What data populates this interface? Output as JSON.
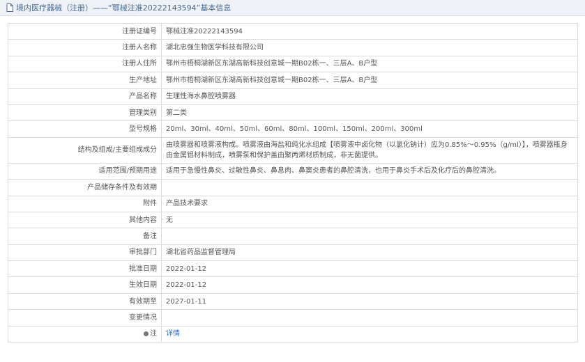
{
  "header": {
    "breadcrumb": "境内医疗器械（注册）——“鄂械注准20222143594”基本信息"
  },
  "rows": [
    {
      "label": "注册证编号",
      "value": "鄂械注准20222143594"
    },
    {
      "label": "注册人名称",
      "value": "湖北忠强生物医学科技有限公司"
    },
    {
      "label": "注册人住所",
      "value": "鄂州市梧桐湖新区东湖高新科技创意城一期B02栋一、三层A、B户型"
    },
    {
      "label": "生产地址",
      "value": "鄂州市梧桐湖新区东湖高新科技创意城一期B02栋一、三层A、B户型"
    },
    {
      "label": "产品名称",
      "value": "生理性海水鼻腔喷雾器"
    },
    {
      "label": "管理类别",
      "value": "第二类"
    },
    {
      "label": "型号规格",
      "value": "20ml、30ml、40ml、50ml、60ml、80ml、100ml、150ml、200ml、300ml"
    },
    {
      "label": "结构及组成/主要组成成分",
      "value": "由喷雾器和喷雾液构成。喷雾液由海盐和纯化水组成【喷雾液中卤化物（以氯化钠计）应为0.85%～0.95%（g/ml）】，喷雾器瓶身由金属铝材料制成，喷雾泵和保护盖由聚丙烯材质制成，非无菌提供。"
    },
    {
      "label": "适用范围/预期用途",
      "value": "适用于急慢性鼻炎、过敏性鼻炎、鼻息肉、鼻窦炎患者的鼻腔清洗，也用于鼻炎手术后及化疗后的鼻腔清洗。"
    },
    {
      "label": "产品储存条件及有效期",
      "value": ""
    },
    {
      "label": "附件",
      "value": "产品技术要求"
    },
    {
      "label": "其他内容",
      "value": "无"
    },
    {
      "label": "备注",
      "value": ""
    },
    {
      "label": "审批部门",
      "value": "湖北省药品监督管理局"
    },
    {
      "label": "批准日期",
      "value": "2022-01-12"
    },
    {
      "label": "生效日期",
      "value": "2022-01-12"
    },
    {
      "label": "有效期至",
      "value": "2027-01-11"
    },
    {
      "label": "变更情况",
      "value": ""
    }
  ],
  "note_row": {
    "label": "注",
    "link": "详情"
  }
}
